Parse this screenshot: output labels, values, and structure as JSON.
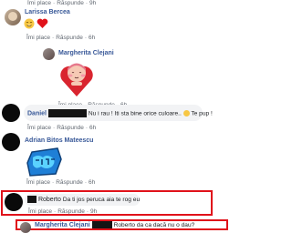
{
  "actions": {
    "like": "Îmi place",
    "reply": "Răspunde",
    "sep": "·"
  },
  "comments": [
    {
      "author": "",
      "time": "9h",
      "partial": true
    },
    {
      "author": "Larissa Bercea",
      "body_emoji": [
        "emoji-face-icon",
        "heart-icon"
      ],
      "time": "6h"
    },
    {
      "author": "Margherita Clejani",
      "sticker": "heart-hug-sticker-icon",
      "time": "6h"
    },
    {
      "author": "Daniel",
      "text": "Nu i rau ! Iti sta bine orice culoare.. ",
      "text_tail": " Te pup !",
      "emoji": "smiley-icon",
      "time": "6h"
    },
    {
      "author": "Adrian Bitos Mateescu",
      "sticker": "super-sticker-icon",
      "time": "6h"
    },
    {
      "author": "Roberto",
      "text": "Da ti jos peruca aia te rog eu",
      "time": "9h",
      "highlight_color": "#e0121a"
    },
    {
      "author": "Margherita Clejani",
      "text": "Roberto da ca dacă nu o dau?",
      "time": "",
      "partial": true,
      "highlight_color": "#e0121a"
    }
  ],
  "colors": {
    "link": "#385898",
    "highlight": "#e0121a",
    "bubble": "#f2f3f5"
  }
}
